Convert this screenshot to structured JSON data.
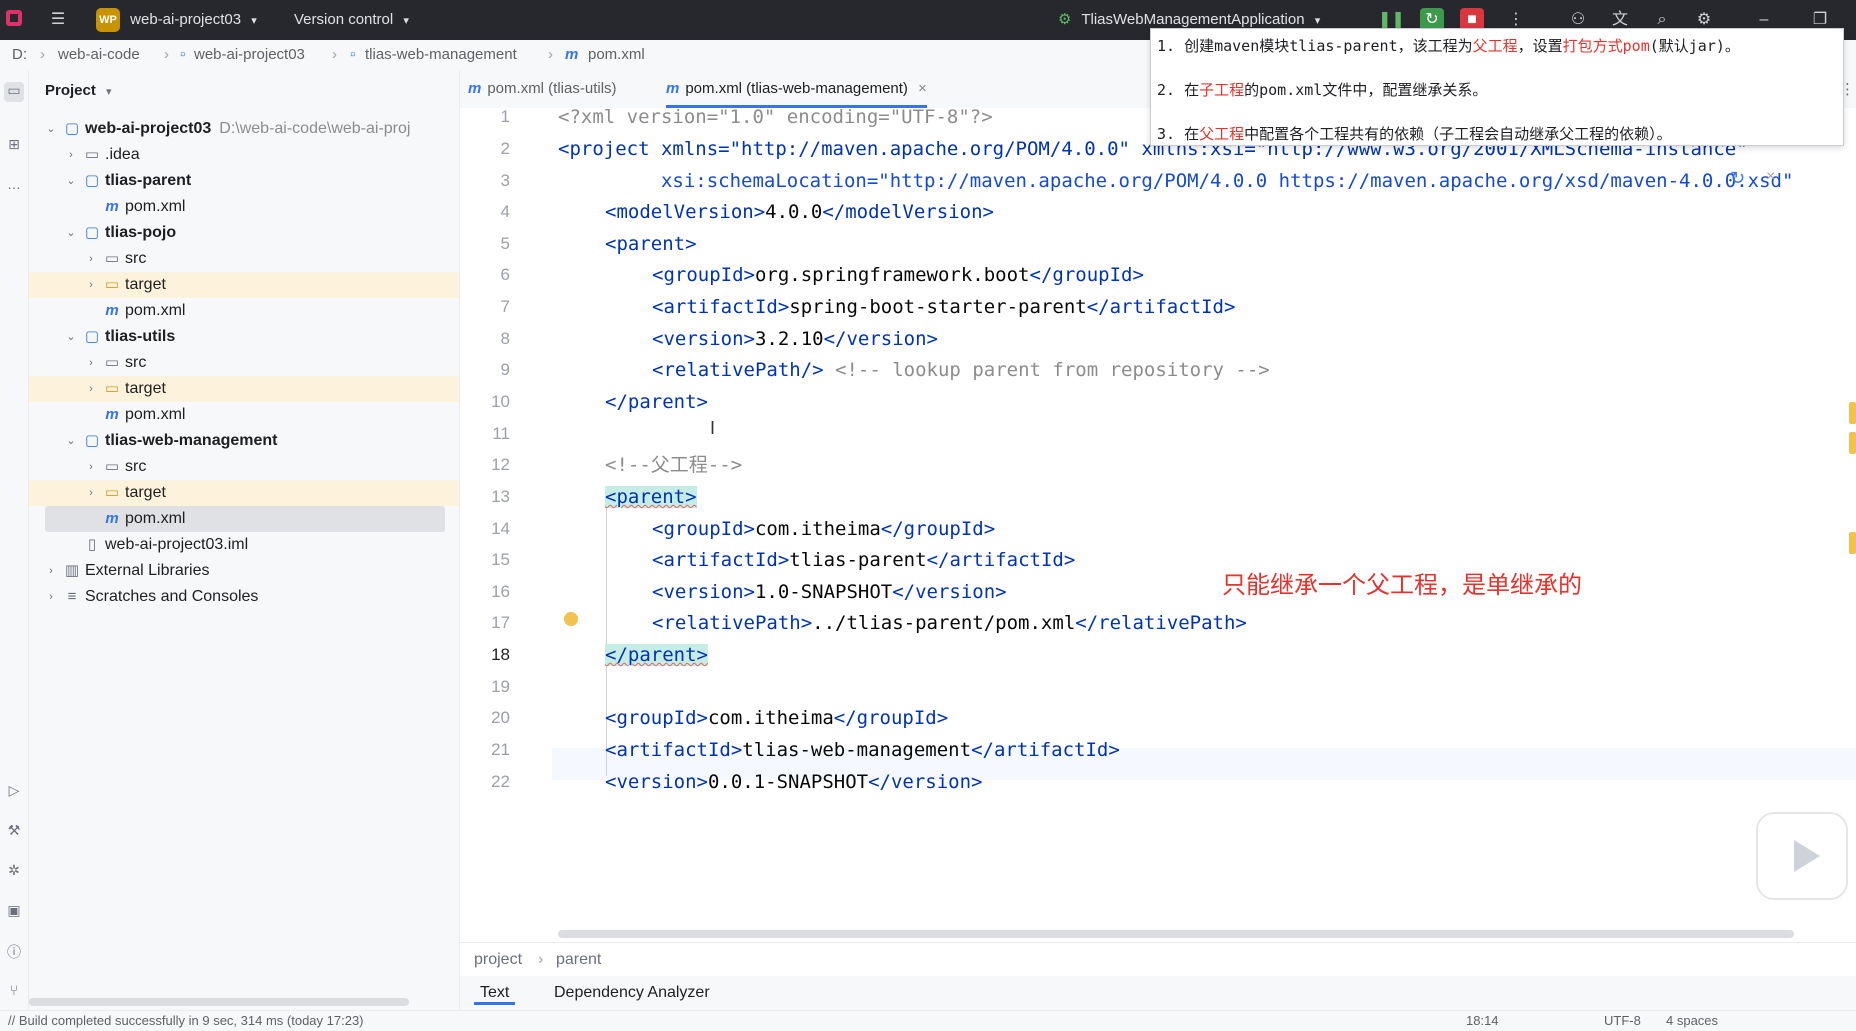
{
  "titlebar": {
    "project_badge": "WP",
    "project_name": "web-ai-project03",
    "vcs_label": "Version control",
    "run_config": "TliasWebManagementApplication"
  },
  "breadcrumb": [
    "D:",
    "web-ai-code",
    "web-ai-project03",
    "tlias-web-management",
    "pom.xml"
  ],
  "project_panel": {
    "title": "Project",
    "root_name": "web-ai-project03",
    "root_path": "D:\\web-ai-code\\web-ai-proj",
    "rows": [
      {
        "label": "web-ai-project03",
        "bold": true
      },
      {
        "label": ".idea"
      },
      {
        "label": "tlias-parent",
        "bold": true
      },
      {
        "label": "pom.xml"
      },
      {
        "label": "tlias-pojo",
        "bold": true
      },
      {
        "label": "src"
      },
      {
        "label": "target"
      },
      {
        "label": "pom.xml"
      },
      {
        "label": "tlias-utils",
        "bold": true
      },
      {
        "label": "src"
      },
      {
        "label": "target"
      },
      {
        "label": "pom.xml"
      },
      {
        "label": "tlias-web-management",
        "bold": true
      },
      {
        "label": "src"
      },
      {
        "label": "target"
      },
      {
        "label": "pom.xml"
      },
      {
        "label": "web-ai-project03.iml"
      },
      {
        "label": "External Libraries"
      },
      {
        "label": "Scratches and Consoles"
      }
    ]
  },
  "tabs": [
    {
      "label": "pom.xml (tlias-utils)"
    },
    {
      "label": "pom.xml (tlias-web-management)",
      "close": "×"
    }
  ],
  "line_numbers": [
    "1",
    "2",
    "3",
    "4",
    "5",
    "6",
    "7",
    "8",
    "9",
    "10",
    "11",
    "12",
    "13",
    "14",
    "15",
    "16",
    "17",
    "18",
    "19",
    "20",
    "21",
    "22"
  ],
  "code": {
    "l1": "<?xml version=\"1.0\" encoding=\"UTF-8\"?>",
    "l2": "<project xmlns=\"http://maven.apache.org/POM/4.0.0\" xmlns:xsi=\"http://www.w3.org/2001/XMLSchema-instance\"",
    "l3": "         xsi:schemaLocation=\"http://maven.apache.org/POM/4.0.0 https://maven.apache.org/xsd/maven-4.0.0.xsd\"",
    "l4_open": "<modelVersion>",
    "l4_val": "4.0.0",
    "l4_close": "</modelVersion>",
    "l5": "<parent>",
    "l6_open": "<groupId>",
    "l6_val": "org.springframework.boot",
    "l6_close": "</groupId>",
    "l7_open": "<artifactId>",
    "l7_val": "spring-boot-starter-parent",
    "l7_close": "</artifactId>",
    "l8_open": "<version>",
    "l8_val": "3.2.10",
    "l8_close": "</version>",
    "l9_tag": "<relativePath/>",
    "l9_comment": "<!-- lookup parent from repository -->",
    "l10": "</parent>",
    "l12": "<!--父工程-->",
    "l13": "<parent>",
    "l14_open": "<groupId>",
    "l14_val": "com.itheima",
    "l14_close": "</groupId>",
    "l15_open": "<artifactId>",
    "l15_val": "tlias-parent",
    "l15_close": "</artifactId>",
    "l16_open": "<version>",
    "l16_val": "1.0-SNAPSHOT",
    "l16_close": "</version>",
    "l17_open": "<relativePath>",
    "l17_val": "../tlias-parent/pom.xml",
    "l17_close": "</relativePath>",
    "l18": "</parent>",
    "l20_open": "<groupId>",
    "l20_val": "com.itheima",
    "l20_close": "</groupId>",
    "l21_open": "<artifactId>",
    "l21_val": "tlias-web-management",
    "l21_close": "</artifactId>",
    "l22_open": "<version>",
    "l22_val": "0.0.1-SNAPSHOT",
    "l22_close": "</version>"
  },
  "annotation": "只能继承一个父工程，是单继承的",
  "popup": {
    "line1_a": "1. 创建maven模块tlias-parent，该工程为",
    "line1_red1": "父工程",
    "line1_b": "，设置",
    "line1_red2": "打包方式pom",
    "line1_c": "(默认jar)。",
    "line2_a": "2. 在",
    "line2_red": "子工程",
    "line2_b": "的pom.xml文件中，配置继承关系。",
    "line3_a": "3. 在",
    "line3_red": "父工程",
    "line3_b": "中配置各个工程共有的依赖（子工程会自动继承父工程的依赖）。"
  },
  "editor_breadcrumb": [
    "project",
    "parent"
  ],
  "bottom_tabs": [
    "Text",
    "Dependency Analyzer"
  ],
  "status": {
    "message": "// Build completed successfully in 9 sec, 314 ms (today 17:23)",
    "position": "18:14",
    "encoding": "UTF-8",
    "indent": "4 spaces"
  }
}
